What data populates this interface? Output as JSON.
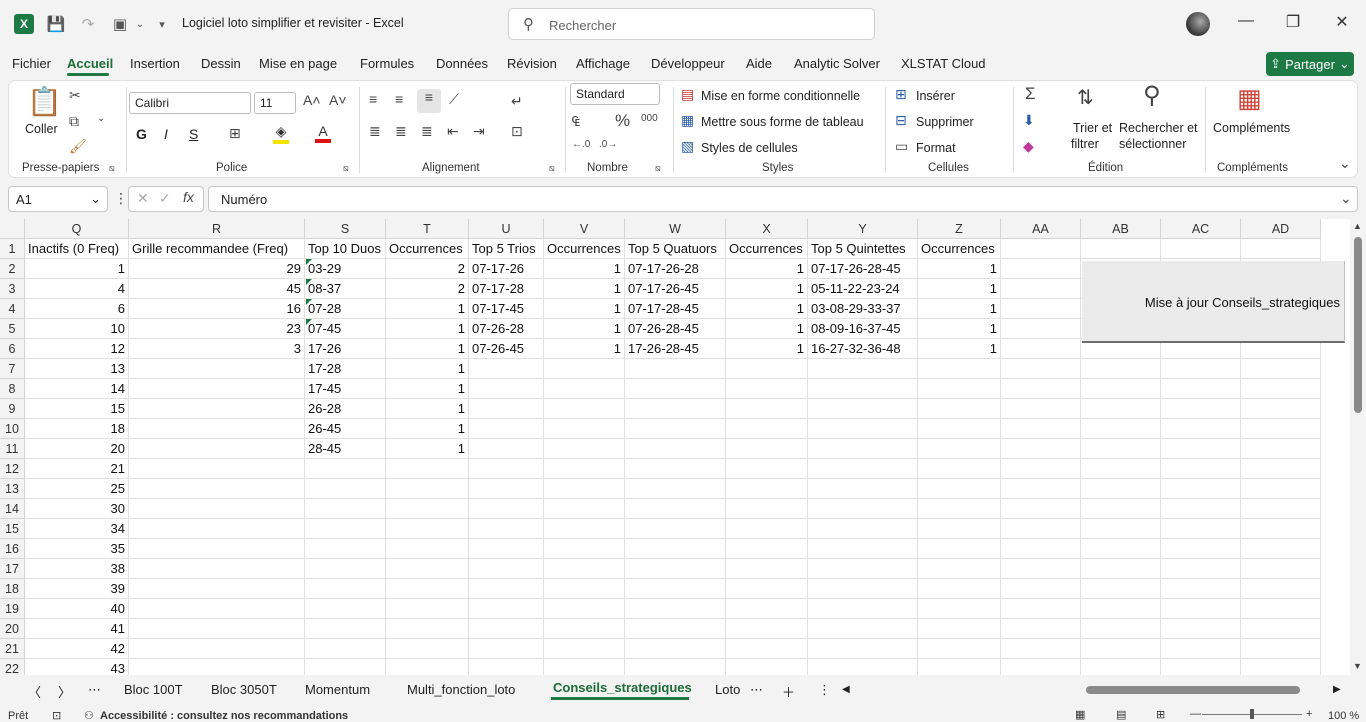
{
  "titlebar": {
    "app_logo": "X",
    "title": "Logiciel loto simplifier et revisiter  -  Excel",
    "search_placeholder": "Rechercher",
    "minimize": "—",
    "maximize": "❐",
    "close": "✕"
  },
  "menu": {
    "items": [
      "Fichier",
      "Accueil",
      "Insertion",
      "Dessin",
      "Mise en page",
      "Formules",
      "Données",
      "Révision",
      "Affichage",
      "Développeur",
      "Aide",
      "Analytic Solver",
      "XLSTAT Cloud"
    ],
    "active": "Accueil",
    "share": "Partager"
  },
  "ribbon": {
    "clipboard": {
      "paste": "Coller",
      "label": "Presse-papiers"
    },
    "font": {
      "name": "Calibri",
      "size": "11",
      "bold": "G",
      "italic": "I",
      "underline": "S",
      "label": "Police"
    },
    "alignment": {
      "label": "Alignement"
    },
    "number": {
      "format": "Standard",
      "label": "Nombre"
    },
    "styles": {
      "conditional": "Mise en forme conditionnelle",
      "table": "Mettre sous forme de tableau",
      "cell_styles": "Styles de cellules",
      "label": "Styles"
    },
    "cells": {
      "insert": "Insérer",
      "delete": "Supprimer",
      "format": "Format",
      "label": "Cellules"
    },
    "editing": {
      "sort": "Trier et",
      "sort2": "filtrer",
      "find": "Rechercher et",
      "find2": "sélectionner",
      "label": "Édition"
    },
    "addins": {
      "button": "Compléments",
      "label": "Compléments"
    }
  },
  "formula_bar": {
    "cell_ref": "A1",
    "content": "Numéro"
  },
  "columns": [
    "Q",
    "R",
    "S",
    "T",
    "U",
    "V",
    "W",
    "X",
    "Y",
    "Z",
    "AA",
    "AB",
    "AC",
    "AD"
  ],
  "rows": [
    [
      "Inactifs (0 Freq)",
      "Grille recommandee (Freq)",
      "Top 10 Duos",
      "Occurrences",
      "Top 5 Trios",
      "Occurrences",
      "Top 5 Quatuors",
      "Occurrences",
      "Top 5 Quintettes",
      "Occurrences"
    ],
    [
      "1",
      "29",
      "03-29",
      "2",
      "07-17-26",
      "1",
      "07-17-26-28",
      "1",
      "07-17-26-28-45",
      "1"
    ],
    [
      "4",
      "45",
      "08-37",
      "2",
      "07-17-28",
      "1",
      "07-17-26-45",
      "1",
      "05-11-22-23-24",
      "1"
    ],
    [
      "6",
      "16",
      "07-28",
      "1",
      "07-17-45",
      "1",
      "07-17-28-45",
      "1",
      "03-08-29-33-37",
      "1"
    ],
    [
      "10",
      "23",
      "07-45",
      "1",
      "07-26-28",
      "1",
      "07-26-28-45",
      "1",
      "08-09-16-37-45",
      "1"
    ],
    [
      "12",
      "3",
      "17-26",
      "1",
      "07-26-45",
      "1",
      "17-26-28-45",
      "1",
      "16-27-32-36-48",
      "1"
    ],
    [
      "13",
      "",
      "17-28",
      "1",
      "",
      "",
      "",
      "",
      "",
      ""
    ],
    [
      "14",
      "",
      "17-45",
      "1",
      "",
      "",
      "",
      "",
      "",
      ""
    ],
    [
      "15",
      "",
      "26-28",
      "1",
      "",
      "",
      "",
      "",
      "",
      ""
    ],
    [
      "18",
      "",
      "26-45",
      "1",
      "",
      "",
      "",
      "",
      "",
      ""
    ],
    [
      "20",
      "",
      "28-45",
      "1",
      "",
      "",
      "",
      "",
      "",
      ""
    ],
    [
      "21",
      "",
      "",
      "",
      "",
      "",
      "",
      "",
      "",
      ""
    ],
    [
      "25",
      "",
      "",
      "",
      "",
      "",
      "",
      "",
      "",
      ""
    ],
    [
      "30",
      "",
      "",
      "",
      "",
      "",
      "",
      "",
      "",
      ""
    ],
    [
      "34",
      "",
      "",
      "",
      "",
      "",
      "",
      "",
      "",
      ""
    ],
    [
      "35",
      "",
      "",
      "",
      "",
      "",
      "",
      "",
      "",
      ""
    ],
    [
      "38",
      "",
      "",
      "",
      "",
      "",
      "",
      "",
      "",
      ""
    ],
    [
      "39",
      "",
      "",
      "",
      "",
      "",
      "",
      "",
      "",
      ""
    ],
    [
      "40",
      "",
      "",
      "",
      "",
      "",
      "",
      "",
      "",
      ""
    ],
    [
      "41",
      "",
      "",
      "",
      "",
      "",
      "",
      "",
      "",
      ""
    ],
    [
      "42",
      "",
      "",
      "",
      "",
      "",
      "",
      "",
      "",
      ""
    ],
    [
      "43",
      "",
      "",
      "",
      "",
      "",
      "",
      "",
      "",
      ""
    ]
  ],
  "macro_button": "Mise à jour Conseils_strategiques",
  "sheet_tabs": [
    "Bloc 100T",
    "Bloc 3050T",
    "Momentum",
    "Multi_fonction_loto",
    "Conseils_strategiques",
    "Loto"
  ],
  "active_tab": "Conseils_strategiques",
  "status": {
    "ready": "Prêt",
    "accessibility": "Accessibilité : consultez nos recommandations",
    "zoom": "100 %"
  },
  "colors": {
    "accent": "#1d7a45"
  }
}
